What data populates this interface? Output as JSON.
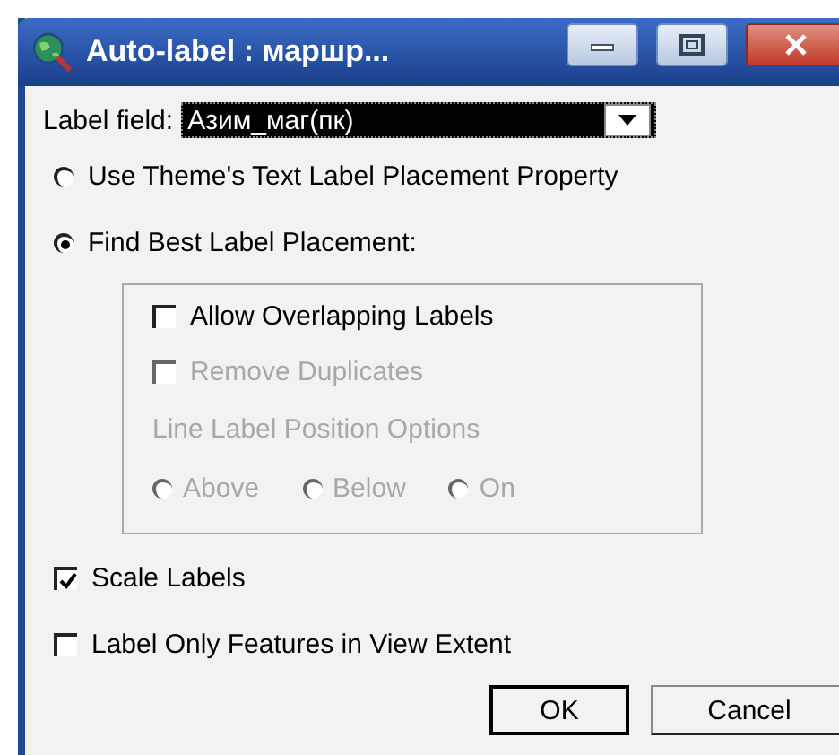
{
  "window": {
    "title": "Auto-label : маршр..."
  },
  "label_field": {
    "label": "Label field:",
    "value": "Азим_маг(пк)"
  },
  "placement_options": [
    {
      "label": "Use Theme's Text Label Placement Property",
      "selected": false
    },
    {
      "label": "Find Best Label Placement:",
      "selected": true
    }
  ],
  "best_placement_group": {
    "options": [
      {
        "label": "Allow Overlapping Labels",
        "checked": false,
        "disabled": false
      },
      {
        "label": "Remove Duplicates",
        "checked": false,
        "disabled": true
      }
    ],
    "line_label_position": {
      "label": "Line Label Position Options",
      "disabled": true,
      "options": [
        {
          "label": "Above",
          "selected": false
        },
        {
          "label": "Below",
          "selected": false
        },
        {
          "label": "On",
          "selected": false
        }
      ]
    }
  },
  "checkboxes": [
    {
      "label": "Scale Labels",
      "checked": true
    },
    {
      "label": "Label Only Features in View Extent",
      "checked": false
    }
  ],
  "buttons": [
    {
      "label": "OK",
      "default": true
    },
    {
      "label": "Cancel",
      "default": false
    }
  ]
}
